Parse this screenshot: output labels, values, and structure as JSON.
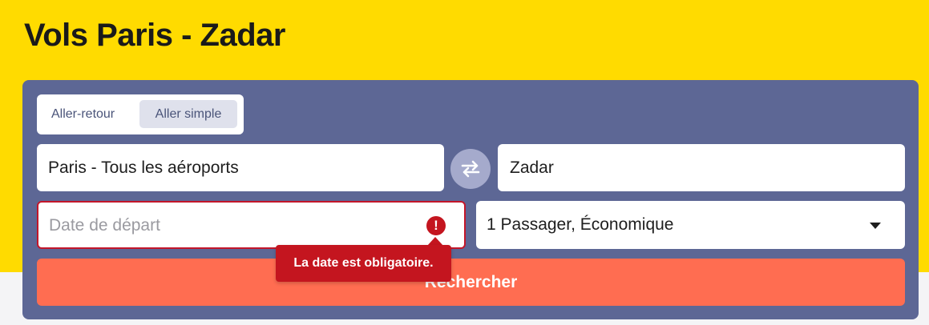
{
  "page": {
    "title": "Vols Paris - Zadar",
    "colors": {
      "hero_bg": "#ffdb00",
      "panel_bg": "#5d6795",
      "search_btn": "#ff6d51",
      "error": "#c4151f"
    }
  },
  "search_form": {
    "trip_type": {
      "options": [
        "Aller-retour",
        "Aller simple"
      ],
      "selected": "Aller simple"
    },
    "origin": {
      "value": "Paris - Tous les aéroports"
    },
    "destination": {
      "value": "Zadar"
    },
    "swap_icon": "swap-arrows-icon",
    "departure_date": {
      "placeholder": "Date de départ",
      "value": "",
      "error_icon": "exclamation-icon"
    },
    "passengers": {
      "value": "1 Passager, Économique",
      "icon": "chevron-down-icon"
    },
    "submit_label": "Rechercher",
    "error_tooltip": "La date est obligatoire."
  }
}
